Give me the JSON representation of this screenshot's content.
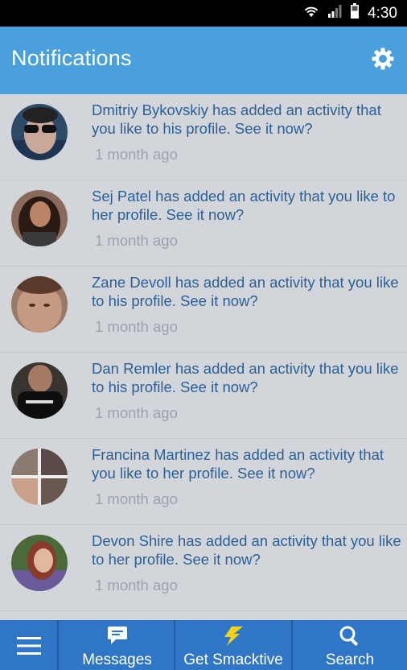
{
  "status_bar": {
    "time": "4:30"
  },
  "header": {
    "title": "Notifications"
  },
  "notifications": [
    {
      "text": "Dmitriy Bykovskiy has added an activity that you like to his profile. See it now?",
      "time": "1 month ago"
    },
    {
      "text": "Sej Patel has added an activity that you like to her profile. See it now?",
      "time": "1 month ago"
    },
    {
      "text": "Zane Devoll has added an activity that you like to his profile. See it now?",
      "time": "1 month ago"
    },
    {
      "text": "Dan Remler has added an activity that you like to his profile. See it now?",
      "time": "1 month ago"
    },
    {
      "text": "Francina Martinez has added an activity that you like to her profile. See it now?",
      "time": "1 month ago"
    },
    {
      "text": "Devon Shire has added an activity that you like to her profile. See it now?",
      "time": "1 month ago"
    }
  ],
  "bottom_nav": {
    "menu_icon": "hamburger-icon",
    "messages": {
      "label": "Messages",
      "icon": "chat-bubble-icon"
    },
    "get_smacktive": {
      "label": "Get Smacktive",
      "icon": "lightning-bolt-icon"
    },
    "search": {
      "label": "Search",
      "icon": "search-icon"
    }
  },
  "colors": {
    "app_bar": "#4aa0dc",
    "bottom_nav": "#2f77c6",
    "list_background": "#d2d6db",
    "message_text": "#2b5f96",
    "timestamp_text": "#9aa3ab",
    "bolt": "#f5d21a"
  }
}
